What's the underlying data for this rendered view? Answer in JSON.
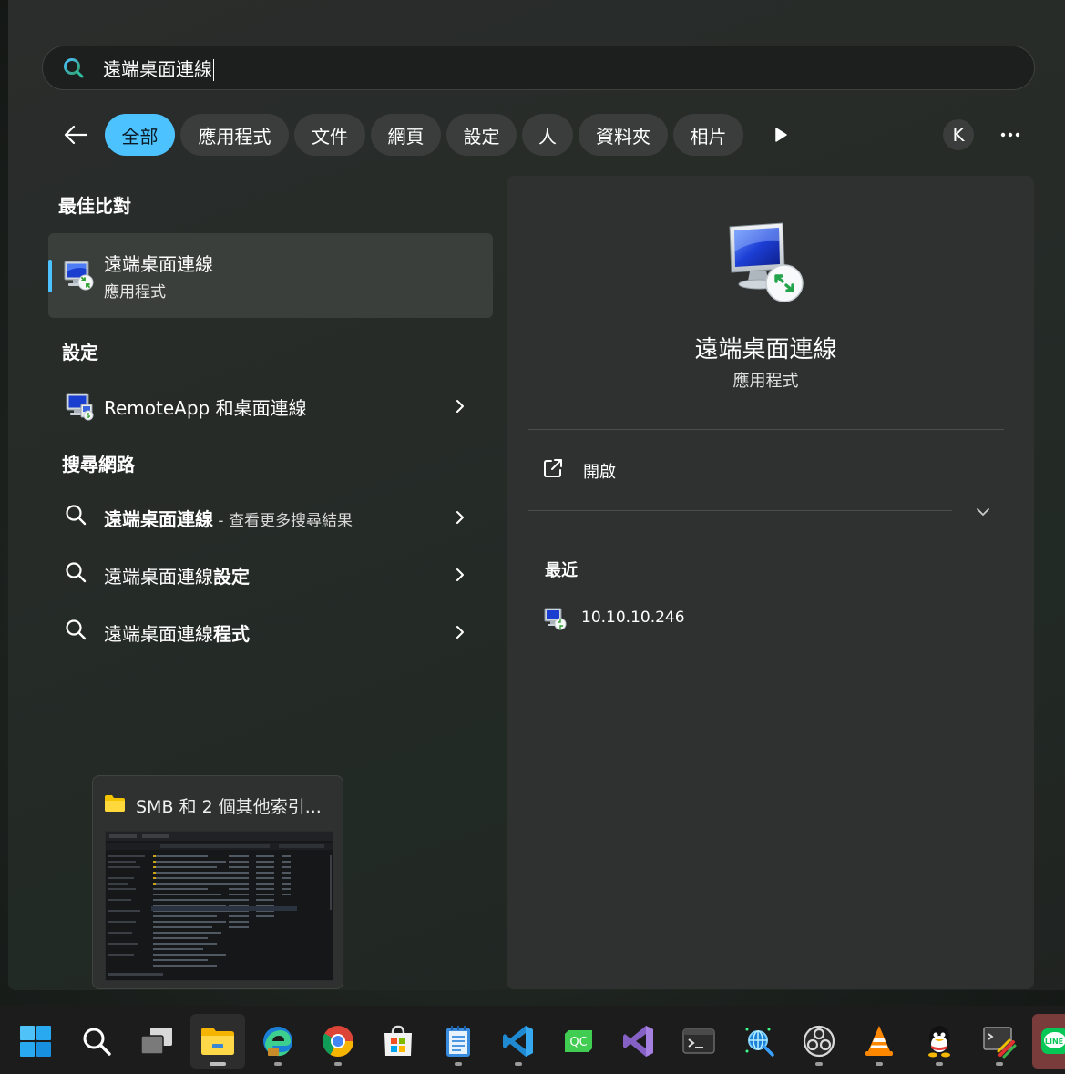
{
  "search": {
    "query": "遠端桌面連線"
  },
  "filters": {
    "chips": [
      "全部",
      "應用程式",
      "文件",
      "網頁",
      "設定",
      "人",
      "資料夾",
      "相片"
    ],
    "account_initial": "K"
  },
  "best_match": {
    "heading": "最佳比對",
    "title": "遠端桌面連線",
    "subtitle": "應用程式"
  },
  "settings": {
    "heading": "設定",
    "items": [
      {
        "label": "RemoteApp 和桌面連線"
      }
    ]
  },
  "web_search": {
    "heading": "搜尋網路",
    "items": [
      {
        "bold": "遠端桌面連線",
        "suffix": " - 查看更多搜尋結果"
      },
      {
        "normal": "遠端桌面連線",
        "bold": "設定"
      },
      {
        "normal": "遠端桌面連線",
        "bold": "程式"
      }
    ]
  },
  "preview": {
    "title": "SMB 和 2 個其他索引..."
  },
  "details": {
    "app_name": "遠端桌面連線",
    "app_type": "應用程式",
    "open_label": "開啟",
    "recent_heading": "最近",
    "recent_items": [
      {
        "label": "10.10.10.246"
      }
    ]
  },
  "colors": {
    "accent": "#4cc2ff",
    "panel": "#262b28",
    "card": "#2e312f"
  },
  "taskbar": {
    "icons": [
      "windows-start-icon",
      "search-icon",
      "task-view-icon",
      "file-explorer-icon",
      "edge-icon",
      "chrome-icon",
      "microsoft-store-icon",
      "notepad-icon",
      "vscode-icon",
      "qc-icon",
      "visual-studio-icon",
      "terminal-icon",
      "network-tool-icon",
      "obs-icon",
      "vlc-icon",
      "qq-icon",
      "remote-desktop-tool-icon",
      "line-icon"
    ]
  }
}
